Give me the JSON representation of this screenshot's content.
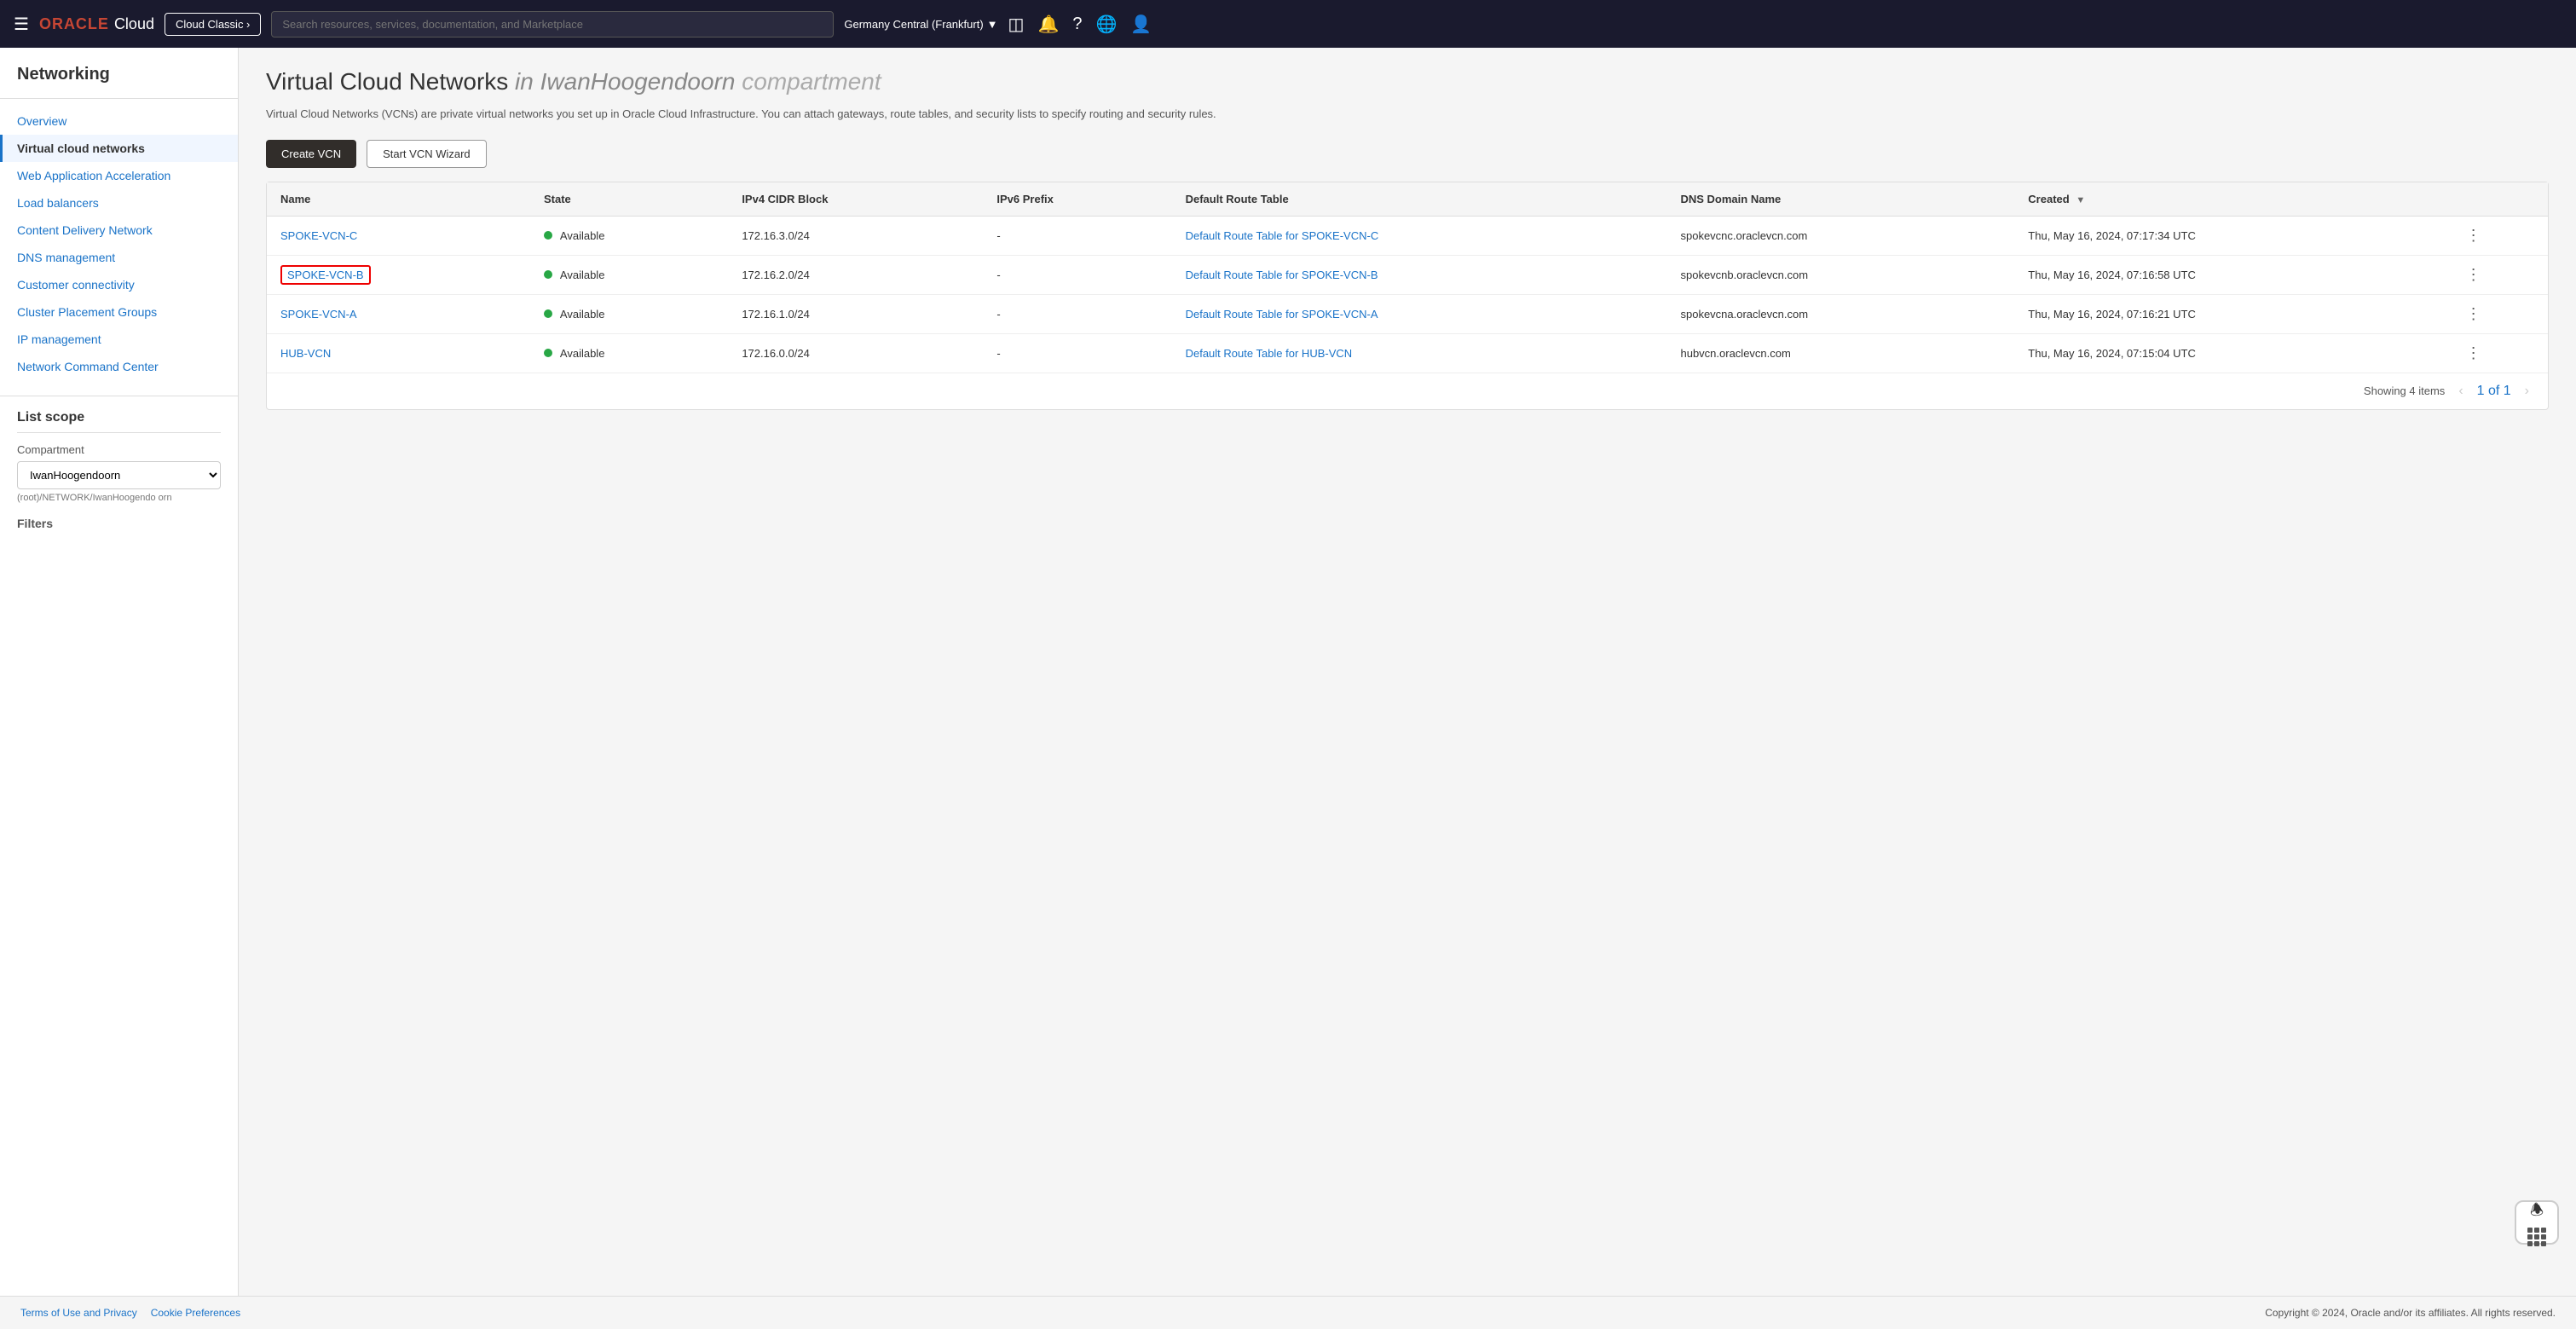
{
  "topNav": {
    "hamburger": "≡",
    "logoOracle": "ORACLE",
    "logoCloud": "Cloud",
    "cloudClassicLabel": "Cloud Classic ›",
    "searchPlaceholder": "Search resources, services, documentation, and Marketplace",
    "region": "Germany Central (Frankfurt)",
    "icons": [
      "⊟",
      "🔔",
      "?",
      "🌐",
      "👤"
    ]
  },
  "sidebar": {
    "title": "Networking",
    "items": [
      {
        "label": "Overview",
        "active": false
      },
      {
        "label": "Virtual cloud networks",
        "active": true
      },
      {
        "label": "Web Application Acceleration",
        "active": false
      },
      {
        "label": "Load balancers",
        "active": false
      },
      {
        "label": "Content Delivery Network",
        "active": false
      },
      {
        "label": "DNS management",
        "active": false
      },
      {
        "label": "Customer connectivity",
        "active": false
      },
      {
        "label": "Cluster Placement Groups",
        "active": false
      },
      {
        "label": "IP management",
        "active": false
      },
      {
        "label": "Network Command Center",
        "active": false
      }
    ],
    "listScope": {
      "title": "List scope",
      "compartmentLabel": "Compartment",
      "compartmentValue": "IwanHoogendoorn",
      "compartmentPath": "(root)/NETWORK/IwanHoogendo orn"
    },
    "filtersLabel": "Filters"
  },
  "page": {
    "titlePart1": "Virtual Cloud Networks",
    "titleIn": "in",
    "titleCompartment": "IwanHoogendoorn",
    "titleCompartmentItalic": "compartment",
    "description": "Virtual Cloud Networks (VCNs) are private virtual networks you set up in Oracle Cloud Infrastructure. You can attach gateways, route tables, and security lists to specify routing and security rules.",
    "createBtn": "Create VCN",
    "wizardBtn": "Start VCN Wizard"
  },
  "table": {
    "columns": [
      {
        "label": "Name"
      },
      {
        "label": "State"
      },
      {
        "label": "IPv4 CIDR Block"
      },
      {
        "label": "IPv6 Prefix"
      },
      {
        "label": "Default Route Table"
      },
      {
        "label": "DNS Domain Name"
      },
      {
        "label": "Created",
        "sortable": true
      }
    ],
    "rows": [
      {
        "name": "SPOKE-VCN-C",
        "highlighted": false,
        "state": "Available",
        "ipv4": "172.16.3.0/24",
        "ipv6": "-",
        "defaultRoute": "Default Route Table for SPOKE-VCN-C",
        "dns": "spokevcnc.oraclevcn.com",
        "created": "Thu, May 16, 2024, 07:17:34 UTC"
      },
      {
        "name": "SPOKE-VCN-B",
        "highlighted": true,
        "state": "Available",
        "ipv4": "172.16.2.0/24",
        "ipv6": "-",
        "defaultRoute": "Default Route Table for SPOKE-VCN-B",
        "dns": "spokevcnb.oraclevcn.com",
        "created": "Thu, May 16, 2024, 07:16:58 UTC"
      },
      {
        "name": "SPOKE-VCN-A",
        "highlighted": false,
        "state": "Available",
        "ipv4": "172.16.1.0/24",
        "ipv6": "-",
        "defaultRoute": "Default Route Table for SPOKE-VCN-A",
        "dns": "spokevcna.oraclevcn.com",
        "created": "Thu, May 16, 2024, 07:16:21 UTC"
      },
      {
        "name": "HUB-VCN",
        "highlighted": false,
        "state": "Available",
        "ipv4": "172.16.0.0/24",
        "ipv6": "-",
        "defaultRoute": "Default Route Table for HUB-VCN",
        "dns": "hubvcn.oraclevcn.com",
        "created": "Thu, May 16, 2024, 07:15:04 UTC"
      }
    ],
    "pagination": {
      "showing": "Showing 4 items",
      "page": "1 of 1"
    }
  },
  "footer": {
    "links": [
      "Terms of Use and Privacy",
      "Cookie Preferences"
    ],
    "copyright": "Copyright © 2024, Oracle and/or its affiliates. All rights reserved."
  }
}
